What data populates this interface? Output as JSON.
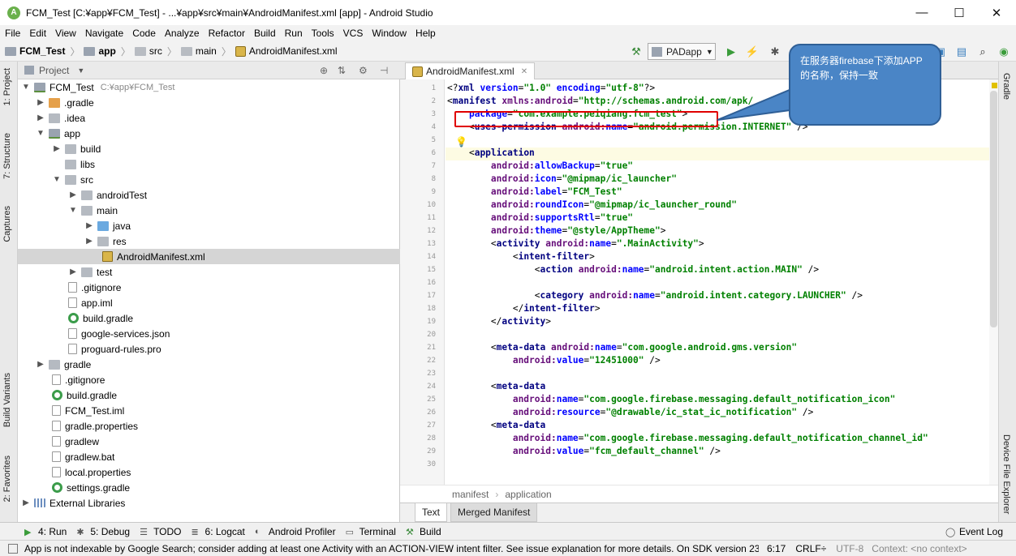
{
  "window": {
    "title": "FCM_Test [C:¥app¥FCM_Test] - ...¥app¥src¥main¥AndroidManifest.xml [app] - Android Studio",
    "minimize": "—",
    "maximize": "☐",
    "close": "✕"
  },
  "menu": [
    "File",
    "Edit",
    "View",
    "Navigate",
    "Code",
    "Analyze",
    "Refactor",
    "Build",
    "Run",
    "Tools",
    "VCS",
    "Window",
    "Help"
  ],
  "nav": {
    "crumbs": [
      "FCM_Test",
      "app",
      "src",
      "main",
      "AndroidManifest.xml"
    ],
    "run_config": "PADapp"
  },
  "left_tabs": [
    "1: Project",
    "7: Structure",
    "Captures",
    "Build Variants",
    "2: Favorites"
  ],
  "right_tabs": [
    "Gradle",
    "Device File Explorer"
  ],
  "project": {
    "header": "Project",
    "tree": [
      {
        "label": "FCM_Test",
        "extra": "C:¥app¥FCM_Test"
      },
      {
        "label": ".gradle"
      },
      {
        "label": ".idea"
      },
      {
        "label": "app"
      },
      {
        "label": "build"
      },
      {
        "label": "libs"
      },
      {
        "label": "src"
      },
      {
        "label": "androidTest"
      },
      {
        "label": "main"
      },
      {
        "label": "java"
      },
      {
        "label": "res"
      },
      {
        "label": "AndroidManifest.xml"
      },
      {
        "label": "test"
      },
      {
        "label": ".gitignore"
      },
      {
        "label": "app.iml"
      },
      {
        "label": "build.gradle"
      },
      {
        "label": "google-services.json"
      },
      {
        "label": "proguard-rules.pro"
      },
      {
        "label": "gradle"
      },
      {
        "label": ".gitignore"
      },
      {
        "label": "build.gradle"
      },
      {
        "label": "FCM_Test.iml"
      },
      {
        "label": "gradle.properties"
      },
      {
        "label": "gradlew"
      },
      {
        "label": "gradlew.bat"
      },
      {
        "label": "local.properties"
      },
      {
        "label": "settings.gradle"
      },
      {
        "label": "External Libraries"
      }
    ]
  },
  "editor": {
    "tab": "AndroidManifest.xml",
    "line_numbers": [
      "1",
      "2",
      "3",
      "4",
      "5",
      "6",
      "7",
      "8",
      "9",
      "10",
      "11",
      "12",
      "13",
      "14",
      "15",
      "16",
      "17",
      "18",
      "19",
      "20",
      "21",
      "22",
      "23",
      "24",
      "25",
      "26",
      "27",
      "28",
      "29",
      "30"
    ],
    "breadcrumb": [
      "manifest",
      "application"
    ],
    "bottom_tabs": [
      "Text",
      "Merged Manifest"
    ]
  },
  "callout": {
    "text": "在服务器firebase下添加APP的名称，保持一致"
  },
  "toolwindows": [
    "4: Run",
    "5: Debug",
    "TODO",
    "6: Logcat",
    "Android Profiler",
    "Terminal",
    "Build",
    "Event Log"
  ],
  "status": {
    "message": "App is not indexable by Google Search; consider adding at least one Activity with an ACTION-VIEW intent filter. See issue explanation for more details. On SDK version 23 ...",
    "position": "6:17",
    "line_sep": "CRLF÷",
    "encoding": "UTF-8",
    "context": "Context: <no context>"
  }
}
